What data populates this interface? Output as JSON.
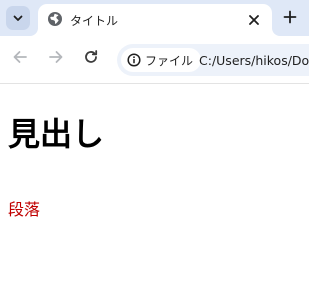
{
  "tab": {
    "title": "タイトル",
    "favicon": "globe-icon",
    "close_icon": "close-icon"
  },
  "tabstrip": {
    "search_icon": "chevron-down-icon",
    "new_tab_icon": "plus-icon"
  },
  "toolbar": {
    "back_icon": "arrow-left-icon",
    "forward_icon": "arrow-right-icon",
    "reload_icon": "reload-icon",
    "site_info_icon": "info-icon",
    "site_chip_label": "ファイル",
    "url": "C:/Users/hikos/Do"
  },
  "page": {
    "heading": "見出し",
    "paragraph": "段落"
  },
  "colors": {
    "tabstrip_bg": "#dfe8f7",
    "omnibox_bg": "#edf2fa",
    "paragraph_color": "#c00000",
    "heading_color": "#000000"
  }
}
